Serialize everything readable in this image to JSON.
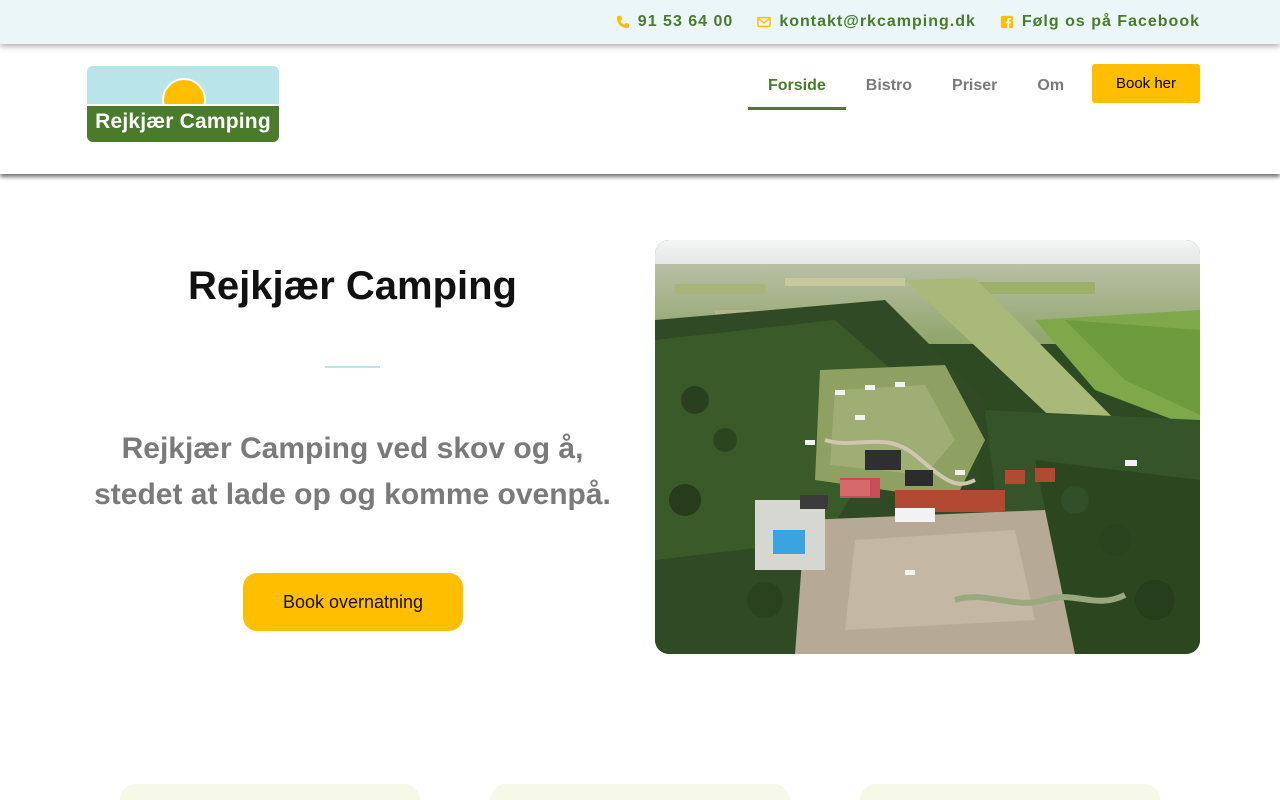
{
  "topbar": {
    "phone": "91 53 64 00",
    "email": "kontakt@rkcamping.dk",
    "facebook": "Følg os på Facebook",
    "icons": [
      "phone-icon",
      "mail-icon",
      "facebook-icon"
    ],
    "text_color": "#4a7b2c",
    "icon_color": "#ffbf00"
  },
  "logo": {
    "text": "Rejkjær Camping"
  },
  "nav": {
    "items": [
      "Forside",
      "Bistro",
      "Priser",
      "Om"
    ],
    "active": "Forside",
    "book_label": "Book her"
  },
  "hero": {
    "title": "Rejkjær Camping",
    "subtitle_line1": "Rejkjær Camping ved skov og å,",
    "subtitle_line2": "stedet at lade op og komme ovenpå.",
    "cta_label": "Book overnatning"
  },
  "colors": {
    "accent_yellow": "#ffbf00",
    "brand_green": "#4a7b2c",
    "light_blue": "#b9e4ea",
    "topbar_bg": "#eaf6f7",
    "card_bg": "#f6f9e7"
  }
}
